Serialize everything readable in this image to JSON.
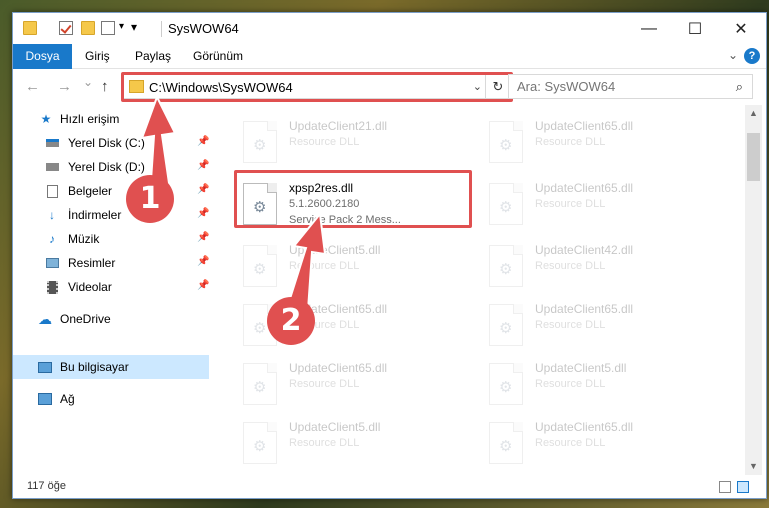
{
  "window": {
    "title": "SysWOW64",
    "minimize": "—",
    "maximize": "☐",
    "close": "✕"
  },
  "ribbon": {
    "tabs": [
      "Dosya",
      "Giriş",
      "Paylaş",
      "Görünüm"
    ]
  },
  "nav": {
    "back": "←",
    "forward": "→",
    "recent": "⌄",
    "up": "↑",
    "address": "C:\\Windows\\SysWOW64",
    "dropdown": "⌄",
    "refresh": "↻",
    "search_placeholder": "Ara: SysWOW64",
    "search_icon": "⌕"
  },
  "sidebar": {
    "items": [
      {
        "label": "Hızlı erişim",
        "icon": "star-icon",
        "pinned": false
      },
      {
        "label": "Yerel Disk (C:)",
        "icon": "drive-icon",
        "pinned": true
      },
      {
        "label": "Yerel Disk (D:)",
        "icon": "drive-icon",
        "pinned": true
      },
      {
        "label": "Belgeler",
        "icon": "document-icon",
        "pinned": true
      },
      {
        "label": "İndirmeler",
        "icon": "download-icon",
        "pinned": true
      },
      {
        "label": "Müzik",
        "icon": "music-icon",
        "pinned": true
      },
      {
        "label": "Resimler",
        "icon": "pictures-icon",
        "pinned": true
      },
      {
        "label": "Videolar",
        "icon": "video-icon",
        "pinned": true
      },
      {
        "label": "OneDrive",
        "icon": "cloud-icon",
        "pinned": false
      },
      {
        "label": "Bu bilgisayar",
        "icon": "computer-icon",
        "pinned": false
      },
      {
        "label": "Ağ",
        "icon": "network-icon",
        "pinned": false
      }
    ]
  },
  "files": {
    "left": [
      {
        "name": "UpdateClient21.dll",
        "line2": "Resource DLL",
        "line3": ""
      },
      {
        "name": "xpsp2res.dll",
        "line2": "5.1.2600.2180",
        "line3": "Service Pack 2 Mess..."
      },
      {
        "name": "UpdateClient5.dll",
        "line2": "Resource DLL",
        "line3": ""
      },
      {
        "name": "UpdateClient65.dll",
        "line2": "Resource DLL",
        "line3": ""
      },
      {
        "name": "UpdateClient65.dll",
        "line2": "Resource DLL",
        "line3": ""
      },
      {
        "name": "UpdateClient5.dll",
        "line2": "Resource DLL",
        "line3": ""
      }
    ],
    "right": [
      {
        "name": "UpdateClient65.dll",
        "line2": "Resource DLL"
      },
      {
        "name": "UpdateClient65.dll",
        "line2": "Resource DLL"
      },
      {
        "name": "UpdateClient42.dll",
        "line2": "Resource DLL"
      },
      {
        "name": "UpdateClient65.dll",
        "line2": "Resource DLL"
      },
      {
        "name": "UpdateClient5.dll",
        "line2": "Resource DLL"
      },
      {
        "name": "UpdateClient65.dll",
        "line2": "Resource DLL"
      }
    ]
  },
  "status": {
    "count": "117 öğe"
  },
  "annotations": {
    "step1": "1",
    "step2": "2",
    "color": "#e05050"
  }
}
